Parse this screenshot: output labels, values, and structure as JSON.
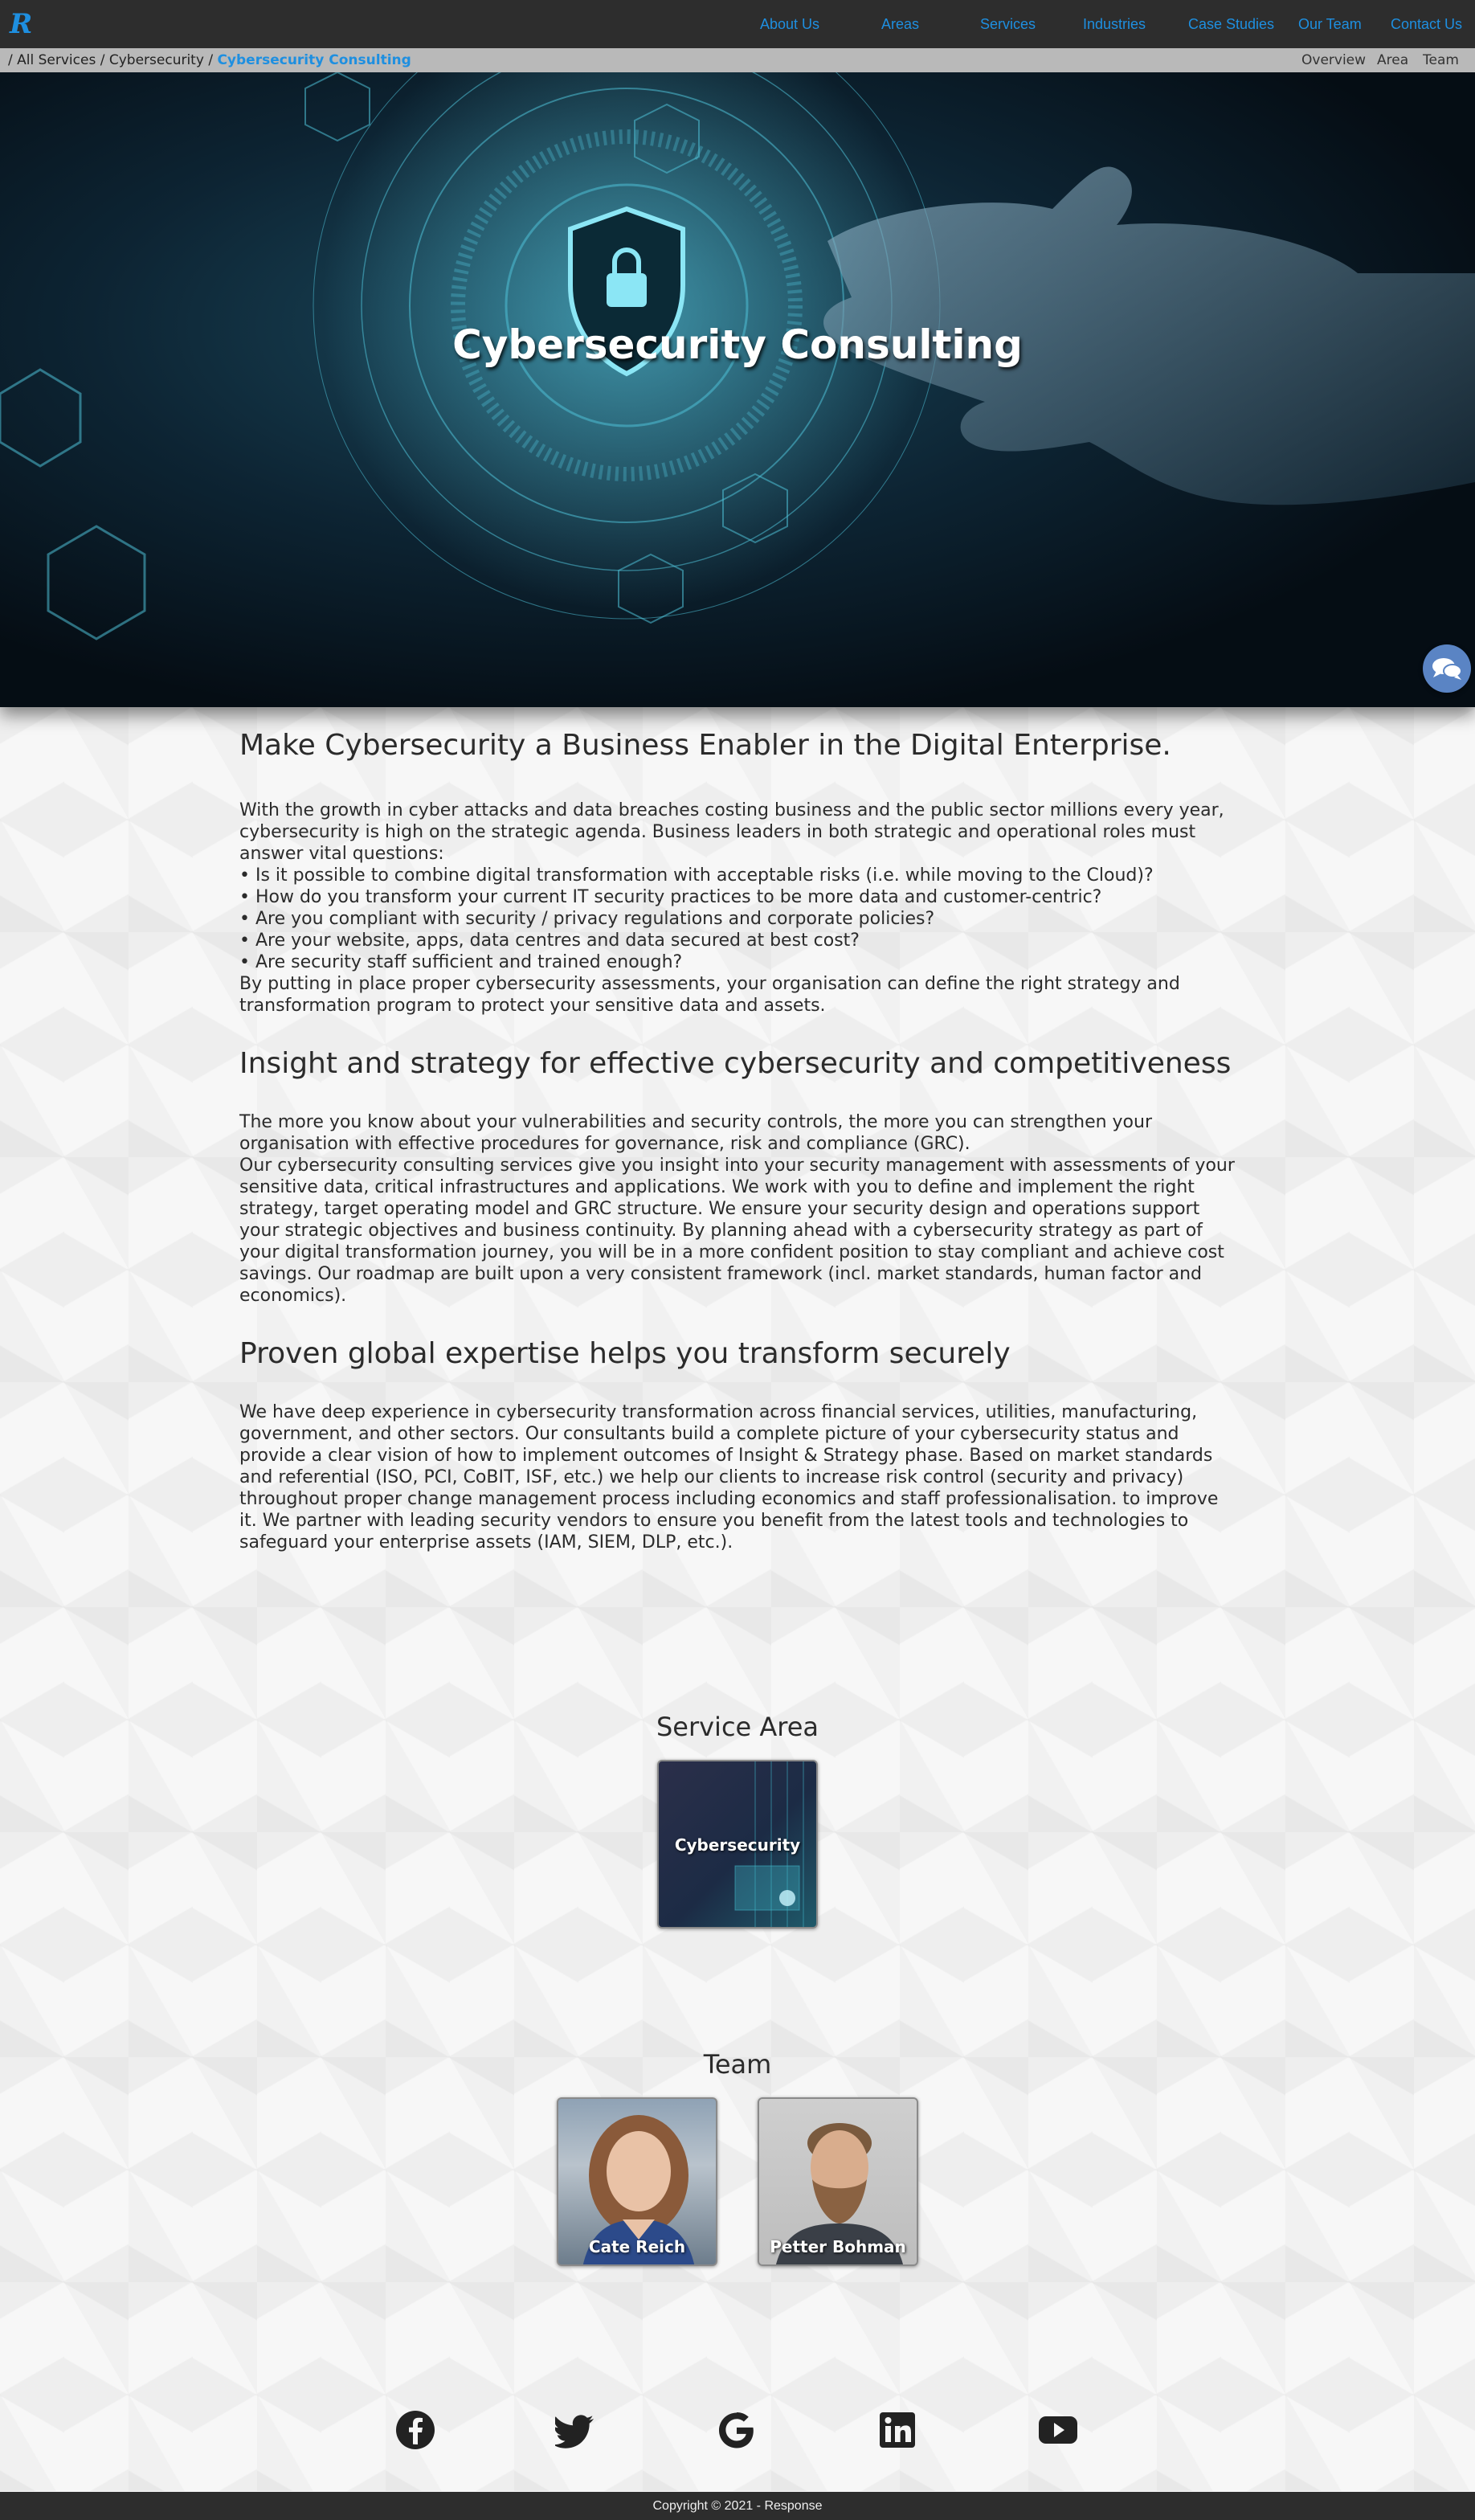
{
  "nav": {
    "logo_icon": "response-r-logo-icon",
    "items": [
      "About Us",
      "Areas",
      "Services",
      "Industries",
      "Case Studies",
      "Our Team",
      "Contact Us"
    ]
  },
  "breadcrumb": {
    "all_services": "All Services",
    "parent": "Cybersecurity",
    "current": "Cybersecurity Consulting",
    "separator": "/"
  },
  "subnav": [
    "Overview",
    "Area",
    "Team"
  ],
  "hero": {
    "title": "Cybersecurity Consulting"
  },
  "sections": [
    {
      "heading": "Make Cybersecurity a Business Enabler in the Digital Enterprise.",
      "lines": [
        "With the growth in cyber attacks and data breaches costing business and the public sector millions every year, cybersecurity is high on the strategic agenda. Business leaders in both strategic and operational roles must answer vital questions:",
        "• Is it possible to combine digital transformation with acceptable risks (i.e. while moving to the Cloud)?",
        "• How do you transform your current IT security practices to be more data and customer-centric?",
        "• Are you compliant with security / privacy regulations and corporate policies?",
        "• Are your website, apps, data centres and data secured at best cost?",
        "• Are security staff sufficient and trained enough?",
        "By putting in place proper cybersecurity assessments, your organisation can define the right strategy and transformation program to protect your sensitive data and assets."
      ]
    },
    {
      "heading": "Insight and strategy for effective cybersecurity and competitiveness",
      "lines": [
        "The more you know about your vulnerabilities and security controls, the more you can strengthen your organisation with effective procedures for governance, risk and compliance (GRC).",
        "Our cybersecurity consulting services give you insight into your security management with assessments of your sensitive data, critical infrastructures and applications. We work with you to define and implement the right strategy, target operating model and GRC structure. We ensure your security design and operations support your strategic objectives and business continuity. By planning ahead with a cybersecurity strategy as part of your digital transformation journey, you will be in a more confident position to stay compliant and achieve cost savings. Our roadmap are built upon a very consistent framework (incl. market standards, human factor and economics)."
      ]
    },
    {
      "heading": "Proven global expertise helps you transform securely",
      "lines": [
        "We have deep experience in cybersecurity transformation across financial services, utilities, manufacturing, government, and other sectors. Our consultants build a complete picture of your cybersecurity status and provide a clear vision of how to implement outcomes of Insight & Strategy phase. Based on market standards and referential (ISO, PCI, CoBIT, ISF, etc.) we help our clients to increase risk control (security and privacy) throughout proper change management process including economics and staff professionalisation. to improve it. We partner with leading security vendors to ensure you benefit from the latest tools and technologies to safeguard your enterprise assets (IAM, SIEM, DLP, etc.)."
      ]
    }
  ],
  "service_area": {
    "title": "Service Area",
    "card_label": "Cybersecurity"
  },
  "team": {
    "title": "Team",
    "members": [
      "Cate Reich",
      "Petter Bohman"
    ]
  },
  "social": [
    "facebook-icon",
    "twitter-icon",
    "google-icon",
    "linkedin-icon",
    "youtube-icon"
  ],
  "footer": {
    "copyright": "Copyright © 2021 - Response"
  },
  "colors": {
    "accent": "#1e8fe0",
    "nav_bg": "#2d2d2d",
    "crumb_bg": "#b9b9b9",
    "chat_button": "#5a84c4"
  }
}
